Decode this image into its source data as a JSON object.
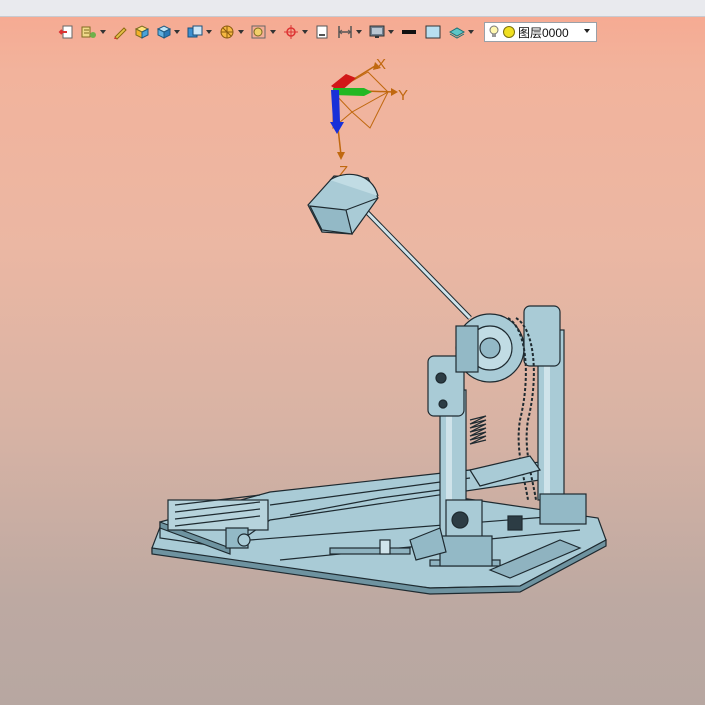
{
  "toolbar": {
    "layer_dropdown": {
      "selected": "图层0000"
    }
  },
  "triad": {
    "x_label": "X",
    "y_label": "Y",
    "z_label": "Z"
  },
  "colors": {
    "model": "#a9cbd6",
    "outline": "#1e2a30",
    "triad_orange": "#c0680f"
  }
}
